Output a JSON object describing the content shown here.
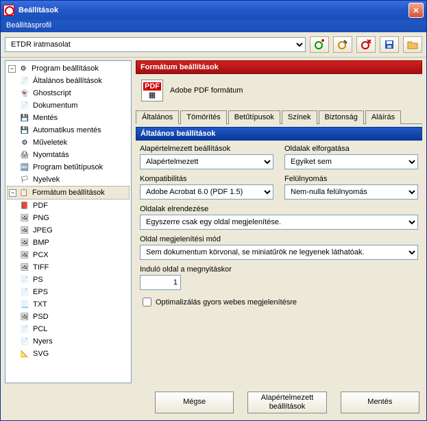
{
  "window": {
    "title": "Beállítások",
    "subtitle": "Beállításprofil"
  },
  "profile": {
    "value": "ETDR iratmasolat"
  },
  "tree": {
    "root1": "Program beállítások",
    "items1": [
      "Általános beállítások",
      "Ghostscript",
      "Dokumentum",
      "Mentés",
      "Automatikus mentés",
      "Műveletek",
      "Nyomtatás",
      "Program betűtípusok",
      "Nyelvek"
    ],
    "root2": "Formátum beállítások",
    "items2": [
      "PDF",
      "PNG",
      "JPEG",
      "BMP",
      "PCX",
      "TIFF",
      "PS",
      "EPS",
      "TXT",
      "PSD",
      "PCL",
      "Nyers",
      "SVG"
    ]
  },
  "format": {
    "section": "Formátum beállítások",
    "name": "Adobe PDF formátum"
  },
  "tabs": [
    "Általános",
    "Tömörítés",
    "Betűtípusok",
    "Színek",
    "Biztonság",
    "Aláírás"
  ],
  "general": {
    "header": "Általános beállítások",
    "defaults_label": "Alapértelmezett beállítások",
    "defaults_value": "Alapértelmezett",
    "rotation_label": "Oldalak elforgatása",
    "rotation_value": "Egyiket sem",
    "compat_label": "Kompatibilitás",
    "compat_value": "Adobe Acrobat 6.0 (PDF 1.5)",
    "overprint_label": "Felülnyomás",
    "overprint_value": "Nem-nulla felülnyomás",
    "layout_label": "Oldalak elrendezése",
    "layout_value": "Egyszerre csak egy oldal megjelenítése.",
    "pagemode_label": "Oldal megjelenítési mód",
    "pagemode_value": "Sem dokumentum körvonal, se miniatűrök ne legyenek láthatóak.",
    "startpage_label": "Induló oldal a megnyitáskor",
    "startpage_value": "1",
    "optimize_label": "Optimalizálás gyors webes megjelenítésre"
  },
  "buttons": {
    "cancel": "Mégse",
    "defaults": "Alapértelmezett beállítások",
    "save": "Mentés"
  }
}
